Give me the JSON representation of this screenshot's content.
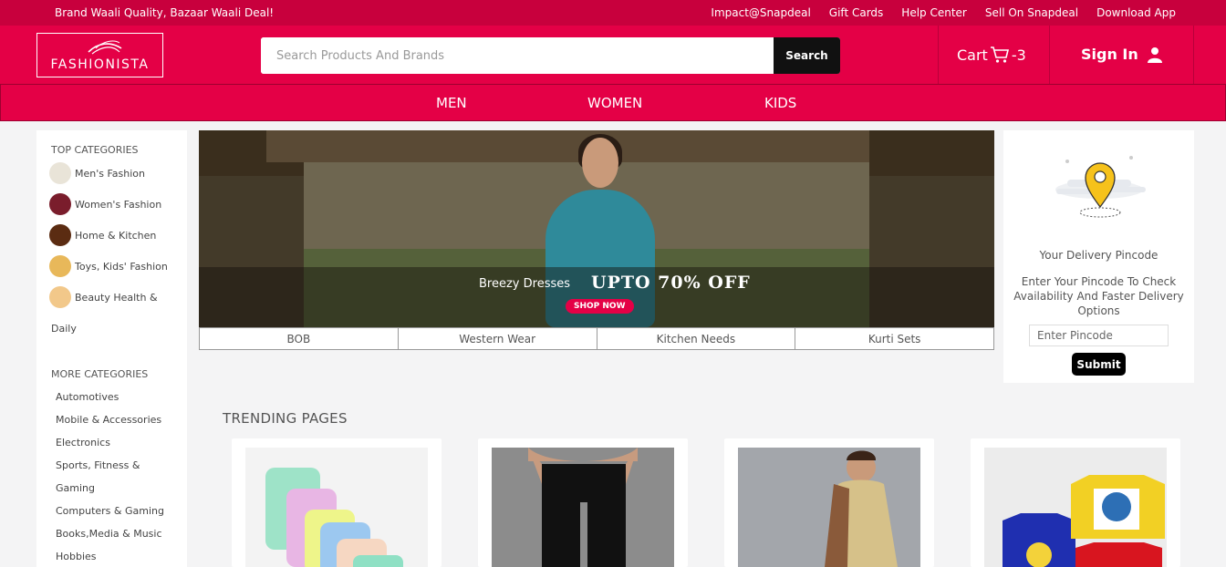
{
  "topbar": {
    "promo": "Brand Waali Quality, Bazaar Waali Deal!",
    "links": [
      "Impact@Snapdeal",
      "Gift Cards",
      "Help Center",
      "Sell On Snapdeal",
      "Download App"
    ]
  },
  "header": {
    "logo": "FASHIONISTA",
    "search_placeholder": "Search Products And Brands",
    "search_button": "Search",
    "cart_label": "Cart",
    "cart_count": "-3",
    "signin_label": "Sign In"
  },
  "nav": {
    "items": [
      "MEN",
      "WOMEN",
      "KIDS"
    ]
  },
  "sidebar": {
    "top_heading": "TOP CATEGORIES",
    "top_categories": [
      "Men's Fashion",
      "Women's Fashion",
      "Home & Kitchen",
      "Toys, Kids' Fashion",
      "Beauty Health &",
      "Daily"
    ],
    "more_heading": "MORE CATEGORIES",
    "more_categories": [
      "Automotives",
      "Mobile & Accessories",
      "Electronics",
      "Sports, Fitness &",
      "Gaming",
      "Computers & Gaming",
      "Books,Media & Music",
      "Hobbies"
    ]
  },
  "banner": {
    "caption": "Breezy Dresses",
    "offer": "UPTO 70% OFF",
    "cta": "SHOP NOW",
    "tabs": [
      "BOB",
      "Western Wear",
      "Kitchen Needs",
      "Kurti Sets"
    ]
  },
  "pincode": {
    "title": "Your Delivery Pincode",
    "description": "Enter Your Pincode To Check Availability And Faster Delivery Options",
    "placeholder": "Enter Pincode",
    "submit": "Submit"
  },
  "trending": {
    "title": "TRENDING PAGES"
  },
  "colors": {
    "brand_red": "#e40046",
    "topbar_red": "#c8003d",
    "black": "#111111"
  }
}
